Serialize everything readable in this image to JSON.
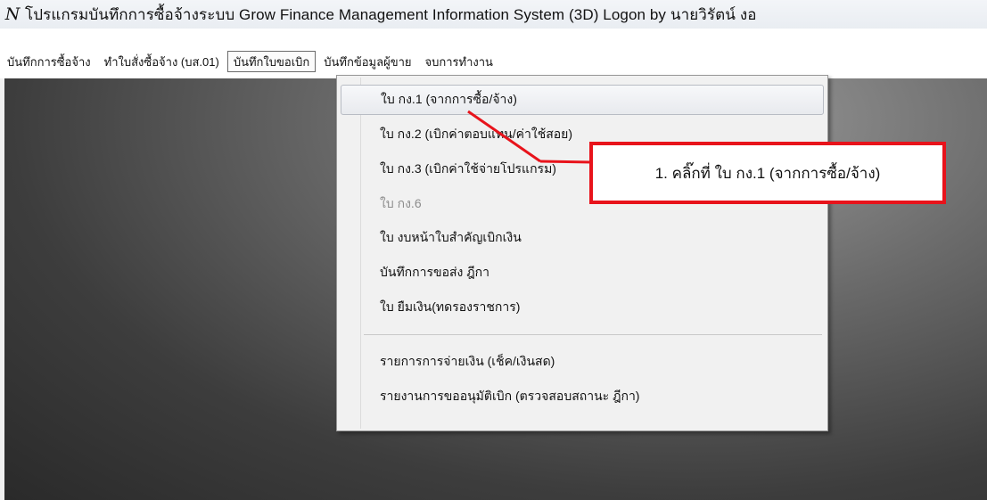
{
  "window": {
    "app_icon_glyph": "N",
    "title": "โปรแกรมบันทึกการซื้อจ้างระบบ  Grow Finance Management Information System (3D) Logon by นายวิรัตน์  งอ"
  },
  "menubar": {
    "items": [
      {
        "label": "บันทึกการซื้อจ้าง"
      },
      {
        "label": "ทำใบสั่งซื้อจ้าง (บส.01)"
      },
      {
        "label": "บันทึกใบขอเบิก"
      },
      {
        "label": "บันทึกข้อมูลผู้ขาย"
      },
      {
        "label": "จบการทำงาน"
      }
    ],
    "active_index": 2
  },
  "dropdown": {
    "items": [
      {
        "label": "ใบ กง.1 (จากการซื้อ/จ้าง)",
        "state": "highlighted"
      },
      {
        "label": "ใบ กง.2 (เบิกค่าตอบแทน/ค่าใช้สอย)",
        "state": "normal"
      },
      {
        "label": "ใบ กง.3 (เบิกค่าใช้จ่ายโปรแกรม)",
        "state": "normal"
      },
      {
        "label": "ใบ กง.6",
        "state": "disabled"
      },
      {
        "label": "ใบ งบหน้าใบสำคัญเบิกเงิน",
        "state": "normal"
      },
      {
        "label": "บันทึกการขอส่ง ฎีกา",
        "state": "normal"
      },
      {
        "label": "ใบ ยืมเงิน(ทดรองราชการ)",
        "state": "normal"
      },
      {
        "label": "รายการการจ่ายเงิน (เช็ค/เงินสด)",
        "state": "normal"
      },
      {
        "label": "รายงานการขออนุมัติเบิก (ตรวจสอบสถานะ ฎีกา)",
        "state": "normal"
      }
    ]
  },
  "annotation": {
    "text": "1. คลิ๊กที่ ใบ กง.1 (จากการซื้อ/จ้าง)",
    "color": "#e8131b"
  }
}
